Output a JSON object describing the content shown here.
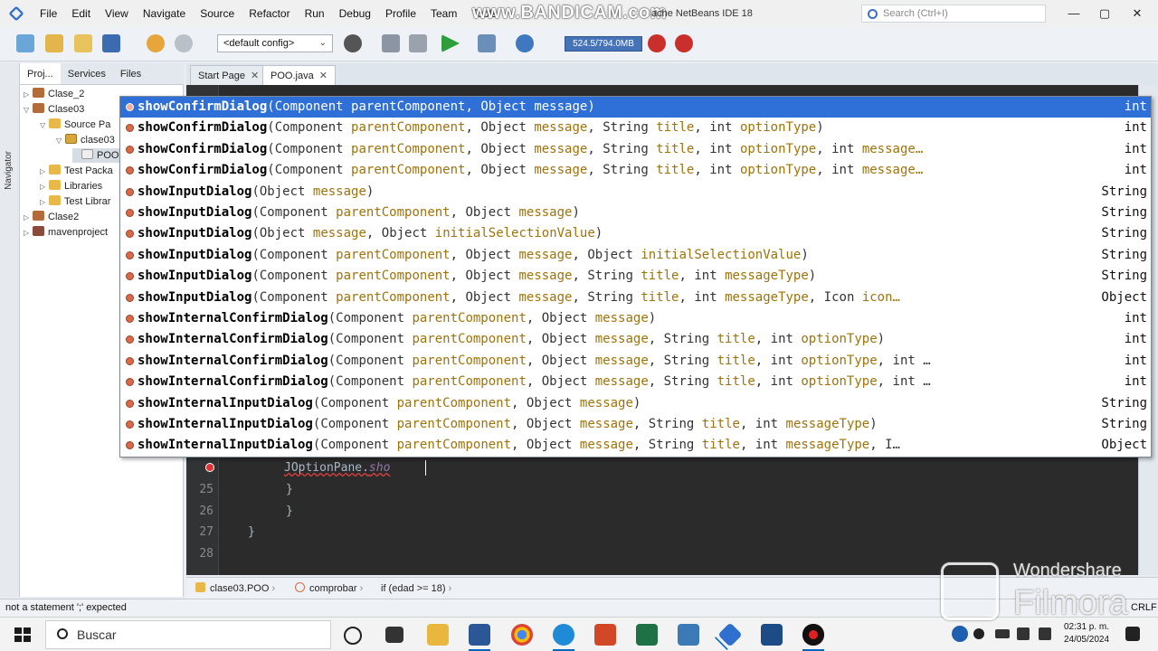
{
  "menubar": {
    "items": [
      "File",
      "Edit",
      "View",
      "Navigate",
      "Source",
      "Refactor",
      "Run",
      "Debug",
      "Profile",
      "Team",
      "Tools"
    ],
    "watermark": "www.BANDICAM.com",
    "window_title": "ache NetBeans IDE 18",
    "search_placeholder": "Search (Ctrl+I)",
    "window_controls": [
      "—",
      "▢",
      "✕"
    ]
  },
  "toolbar": {
    "config_value": "<default config>",
    "memory_label": "524.5/794.0MB"
  },
  "left_panel": {
    "tabs": [
      "Proj...",
      "Services",
      "Files"
    ],
    "navigator_label": "Navigator",
    "tree": [
      {
        "label": "Clase_2",
        "icon": "coffee-cup-icon"
      },
      {
        "label": "Clase03",
        "icon": "coffee-cup-icon"
      },
      {
        "label": "Source Pa",
        "icon": "folder-icon"
      },
      {
        "label": "clase03",
        "icon": "package-icon"
      },
      {
        "label": "POO",
        "icon": "java-file-icon"
      },
      {
        "label": "Test Packa",
        "icon": "folder-icon"
      },
      {
        "label": "Libraries",
        "icon": "folder-icon"
      },
      {
        "label": "Test Librar",
        "icon": "folder-icon"
      },
      {
        "label": "Clase2",
        "icon": "coffee-cup-icon"
      },
      {
        "label": "mavenproject",
        "icon": "maven-icon"
      }
    ]
  },
  "editor": {
    "tabs": [
      {
        "label": "Start Page"
      },
      {
        "label": "POO.java"
      }
    ],
    "line_numbers": [
      "25",
      "26",
      "27",
      "28"
    ],
    "code_lines": {
      "current_prefix": "JOptionPane.",
      "current_typed": "sho",
      "line25": "}",
      "line26": "}",
      "line27": "}"
    }
  },
  "completion": {
    "items": [
      {
        "name": "showConfirmDialog",
        "params": [
          [
            "Component ",
            "parentComponent"
          ],
          [
            ", Object ",
            "message"
          ]
        ],
        "tail": ")",
        "returns": "int"
      },
      {
        "name": "showConfirmDialog",
        "params": [
          [
            "Component ",
            "parentComponent"
          ],
          [
            ", Object ",
            "message"
          ],
          [
            ", String ",
            "title"
          ],
          [
            ", int ",
            "optionType"
          ]
        ],
        "tail": ")",
        "returns": "int"
      },
      {
        "name": "showConfirmDialog",
        "params": [
          [
            "Component ",
            "parentComponent"
          ],
          [
            ", Object ",
            "message"
          ],
          [
            ", String ",
            "title"
          ],
          [
            ", int ",
            "optionType"
          ],
          [
            ", int ",
            "message…"
          ]
        ],
        "tail": "",
        "returns": "int"
      },
      {
        "name": "showConfirmDialog",
        "params": [
          [
            "Component ",
            "parentComponent"
          ],
          [
            ", Object ",
            "message"
          ],
          [
            ", String ",
            "title"
          ],
          [
            ", int ",
            "optionType"
          ],
          [
            ", int ",
            "message…"
          ]
        ],
        "tail": "",
        "returns": "int"
      },
      {
        "name": "showInputDialog",
        "params": [
          [
            "Object ",
            "message"
          ]
        ],
        "tail": ")",
        "returns": "String"
      },
      {
        "name": "showInputDialog",
        "params": [
          [
            "Component ",
            "parentComponent"
          ],
          [
            ", Object ",
            "message"
          ]
        ],
        "tail": ")",
        "returns": "String"
      },
      {
        "name": "showInputDialog",
        "params": [
          [
            "Object ",
            "message"
          ],
          [
            ", Object ",
            "initialSelectionValue"
          ]
        ],
        "tail": ")",
        "returns": "String"
      },
      {
        "name": "showInputDialog",
        "params": [
          [
            "Component ",
            "parentComponent"
          ],
          [
            ", Object ",
            "message"
          ],
          [
            ", Object ",
            "initialSelectionValue"
          ]
        ],
        "tail": ")",
        "returns": "String"
      },
      {
        "name": "showInputDialog",
        "params": [
          [
            "Component ",
            "parentComponent"
          ],
          [
            ", Object ",
            "message"
          ],
          [
            ", String ",
            "title"
          ],
          [
            ", int ",
            "messageType"
          ]
        ],
        "tail": ")",
        "returns": "String"
      },
      {
        "name": "showInputDialog",
        "params": [
          [
            "Component ",
            "parentComponent"
          ],
          [
            ", Object ",
            "message"
          ],
          [
            ", String ",
            "title"
          ],
          [
            ", int ",
            "messageType"
          ],
          [
            ", Icon ",
            "icon…"
          ]
        ],
        "tail": "",
        "returns": "Object"
      },
      {
        "name": "showInternalConfirmDialog",
        "params": [
          [
            "Component ",
            "parentComponent"
          ],
          [
            ", Object ",
            "message"
          ]
        ],
        "tail": ")",
        "returns": "int"
      },
      {
        "name": "showInternalConfirmDialog",
        "params": [
          [
            "Component ",
            "parentComponent"
          ],
          [
            ", Object ",
            "message"
          ],
          [
            ", String ",
            "title"
          ],
          [
            ", int ",
            "optionType"
          ]
        ],
        "tail": ")",
        "returns": "int"
      },
      {
        "name": "showInternalConfirmDialog",
        "params": [
          [
            "Component ",
            "parentComponent"
          ],
          [
            ", Object ",
            "message"
          ],
          [
            ", String ",
            "title"
          ],
          [
            ", int ",
            "optionType"
          ]
        ],
        "tail": ", int …",
        "returns": "int"
      },
      {
        "name": "showInternalConfirmDialog",
        "params": [
          [
            "Component ",
            "parentComponent"
          ],
          [
            ", Object ",
            "message"
          ],
          [
            ", String ",
            "title"
          ],
          [
            ", int ",
            "optionType"
          ]
        ],
        "tail": ", int …",
        "returns": "int"
      },
      {
        "name": "showInternalInputDialog",
        "params": [
          [
            "Component ",
            "parentComponent"
          ],
          [
            ", Object ",
            "message"
          ]
        ],
        "tail": ")",
        "returns": "String"
      },
      {
        "name": "showInternalInputDialog",
        "params": [
          [
            "Component ",
            "parentComponent"
          ],
          [
            ", Object ",
            "message"
          ],
          [
            ", String ",
            "title"
          ],
          [
            ", int ",
            "messageType"
          ]
        ],
        "tail": ")",
        "returns": "String"
      },
      {
        "name": "showInternalInputDialog",
        "params": [
          [
            "Component ",
            "parentComponent"
          ],
          [
            ", Object ",
            "message"
          ],
          [
            ", String ",
            "title"
          ],
          [
            ", int ",
            "messageType"
          ]
        ],
        "tail": ", I…",
        "returns": "Object"
      }
    ]
  },
  "breadcrumb": {
    "items": [
      "clase03.POO",
      "comprobar",
      "if (edad >= 18)"
    ]
  },
  "statusbar": {
    "message": "not a statement ';' expected",
    "right_label": "CRLF"
  },
  "taskbar": {
    "search_placeholder": "Buscar",
    "time": "02:31 p. m.",
    "date": "24/05/2024",
    "apps": [
      "task-view",
      "file-explorer",
      "word",
      "chrome",
      "edge",
      "powerpoint",
      "excel",
      "python",
      "netbeans",
      "vm",
      "bandicam"
    ]
  },
  "filmora": {
    "line1": "Wondershare",
    "line2": "Filmora"
  },
  "colors": {
    "selection": "#2f6fd8",
    "editor_bg": "#2b2b2b",
    "param_name": "#a0720a",
    "error": "#d33333"
  }
}
